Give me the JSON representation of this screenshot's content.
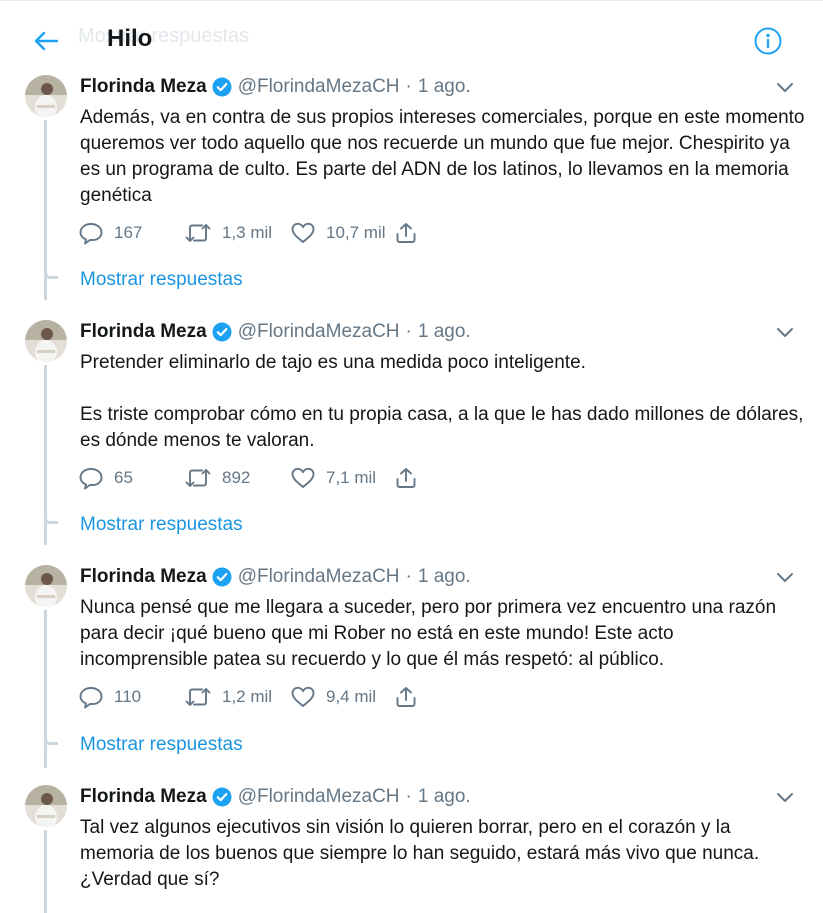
{
  "header": {
    "title": "Hilo",
    "ghost_text": "Mostrar respuestas",
    "accent": "#1da1f2"
  },
  "colors": {
    "link": "#1b95e0",
    "secondary": "#657786",
    "thread_line": "#ccd6dd"
  },
  "tweets": [
    {
      "name": "Florinda Meza",
      "handle": "@FlorindaMezaCH",
      "separator": "·",
      "time": "1 ago.",
      "paragraphs": [
        "Además, va en contra de sus propios intereses comerciales, porque en este momento  queremos ver todo aquello que nos recuerde un mundo que fue mejor. Chespirito ya es un programa de culto. Es parte del ADN de los latinos, lo llevamos en la memoria genética"
      ],
      "replies": "167",
      "retweets": "1,3 mil",
      "likes": "10,7 mil",
      "show_replies": "Mostrar respuestas"
    },
    {
      "name": "Florinda Meza",
      "handle": "@FlorindaMezaCH",
      "separator": "·",
      "time": "1 ago.",
      "paragraphs": [
        "Pretender eliminarlo de tajo es una medida poco inteligente.",
        "Es triste comprobar cómo en tu propia casa, a la que le has dado millones de dólares, es dónde menos te valoran."
      ],
      "replies": "65",
      "retweets": "892",
      "likes": "7,1 mil",
      "show_replies": "Mostrar respuestas"
    },
    {
      "name": "Florinda Meza",
      "handle": "@FlorindaMezaCH",
      "separator": "·",
      "time": "1 ago.",
      "paragraphs": [
        "Nunca pensé que me llegara a suceder,  pero por primera vez encuentro una razón para decir ¡qué bueno que mi Rober no está en este mundo! Este acto incomprensible  patea su recuerdo y lo que él más respetó: al público."
      ],
      "replies": "110",
      "retweets": "1,2 mil",
      "likes": "9,4 mil",
      "show_replies": "Mostrar respuestas"
    },
    {
      "name": "Florinda Meza",
      "handle": "@FlorindaMezaCH",
      "separator": "·",
      "time": "1 ago.",
      "paragraphs": [
        "Tal vez algunos ejecutivos sin visión lo quieren borrar, pero en el corazón y la memoria de los buenos que siempre lo han seguido,  estará más vivo que nunca. ¿Verdad que sí?"
      ]
    }
  ],
  "icons": {
    "back": "arrow-left-icon",
    "info": "info-icon",
    "verified": "verified-badge-icon",
    "caret": "chevron-down-icon",
    "reply": "reply-icon",
    "retweet": "retweet-icon",
    "like": "heart-icon",
    "share": "share-icon"
  }
}
